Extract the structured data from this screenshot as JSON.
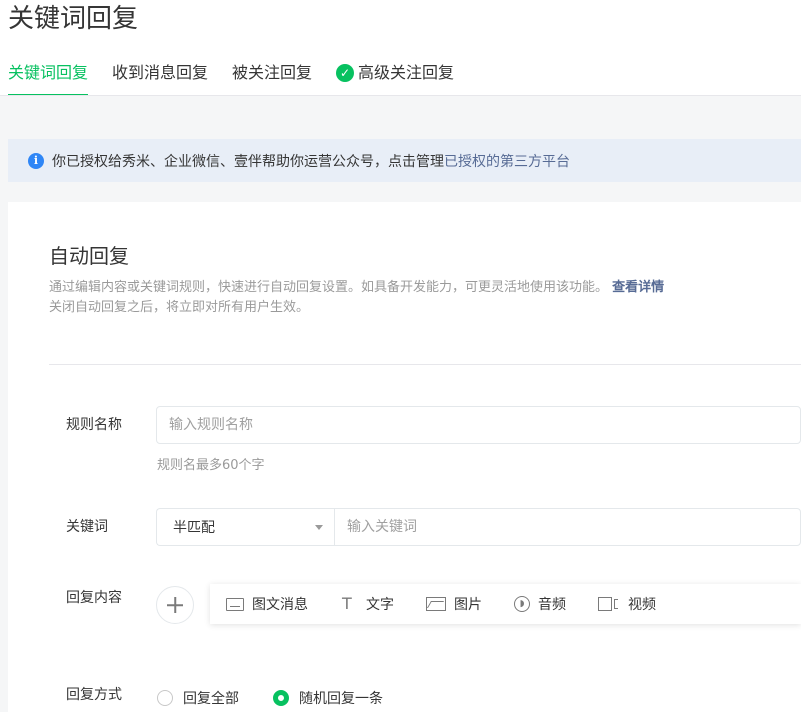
{
  "page": {
    "title": "关键词回复"
  },
  "tabs": [
    {
      "label": "关键词回复",
      "active": true
    },
    {
      "label": "收到消息回复",
      "active": false
    },
    {
      "label": "被关注回复",
      "active": false
    },
    {
      "label": "高级关注回复",
      "active": false,
      "icon": "green-check-badge-icon"
    }
  ],
  "notice": {
    "icon": "info-icon",
    "text": "你已授权给秀米、企业微信、壹伴帮助你运营公众号，点击管理",
    "link": "已授权的第三方平台"
  },
  "auto_reply": {
    "title": "自动回复",
    "description_line1": "通过编辑内容或关键词规则，快速进行自动回复设置。如具备开发能力，可更灵活地使用该功能。",
    "description_link": "查看详情",
    "description_line2": "关闭自动回复之后，将立即对所有用户生效。"
  },
  "form": {
    "rule_name": {
      "label": "规则名称",
      "placeholder": "输入规则名称",
      "value": "",
      "hint": "规则名最多60个字"
    },
    "keyword": {
      "label": "关键词",
      "match_mode": "半匹配",
      "placeholder": "输入关键词",
      "value": ""
    },
    "reply_content": {
      "label": "回复内容",
      "media_types": [
        {
          "label": "图文消息",
          "icon": "article-card-icon"
        },
        {
          "label": "文字",
          "icon": "text-icon"
        },
        {
          "label": "图片",
          "icon": "image-icon"
        },
        {
          "label": "音频",
          "icon": "audio-icon"
        },
        {
          "label": "视频",
          "icon": "video-icon"
        }
      ]
    },
    "reply_mode": {
      "label": "回复方式",
      "options": [
        {
          "label": "回复全部",
          "checked": false
        },
        {
          "label": "随机回复一条",
          "checked": true
        }
      ]
    }
  },
  "colors": {
    "accent": "#07c160",
    "link": "#576b95",
    "info": "#2f86f6",
    "notice_bg": "#e8eef7"
  }
}
